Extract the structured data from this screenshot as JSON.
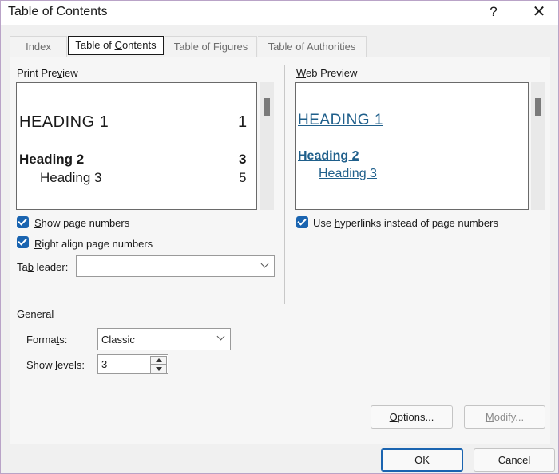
{
  "window": {
    "title": "Table of Contents",
    "help_label": "?",
    "close_label": "✕"
  },
  "tabs": [
    {
      "label": "Index",
      "active": false
    },
    {
      "label": "Table of Contents",
      "active": true
    },
    {
      "label": "Table of Figures",
      "active": false
    },
    {
      "label": "Table of Authorities",
      "active": false
    }
  ],
  "print_preview": {
    "label": "Print Preview",
    "heading1": "HEADING 1",
    "page1": "1",
    "heading2": "Heading 2",
    "page2": "3",
    "heading3": "Heading 3",
    "page3": "5"
  },
  "web_preview": {
    "label": "Web Preview",
    "heading1": "HEADING 1",
    "heading2": "Heading 2",
    "heading3": "Heading 3",
    "link_color": "#1f5f8b"
  },
  "options": {
    "show_page_numbers": {
      "label": "Show page numbers",
      "checked": true
    },
    "right_align": {
      "label": "Right align page numbers",
      "checked": true
    },
    "use_hyperlinks": {
      "label": "Use hyperlinks instead of page numbers",
      "checked": true
    },
    "tab_leader": {
      "label": "Tab leader:",
      "value": ""
    }
  },
  "general": {
    "label": "General",
    "formats_label": "Formats:",
    "formats_value": "Classic",
    "show_levels_label": "Show levels:",
    "show_levels_value": "3"
  },
  "buttons": {
    "options": "Options...",
    "modify": "Modify...",
    "ok": "OK",
    "cancel": "Cancel"
  },
  "colors": {
    "accent": "#1a64b0"
  }
}
